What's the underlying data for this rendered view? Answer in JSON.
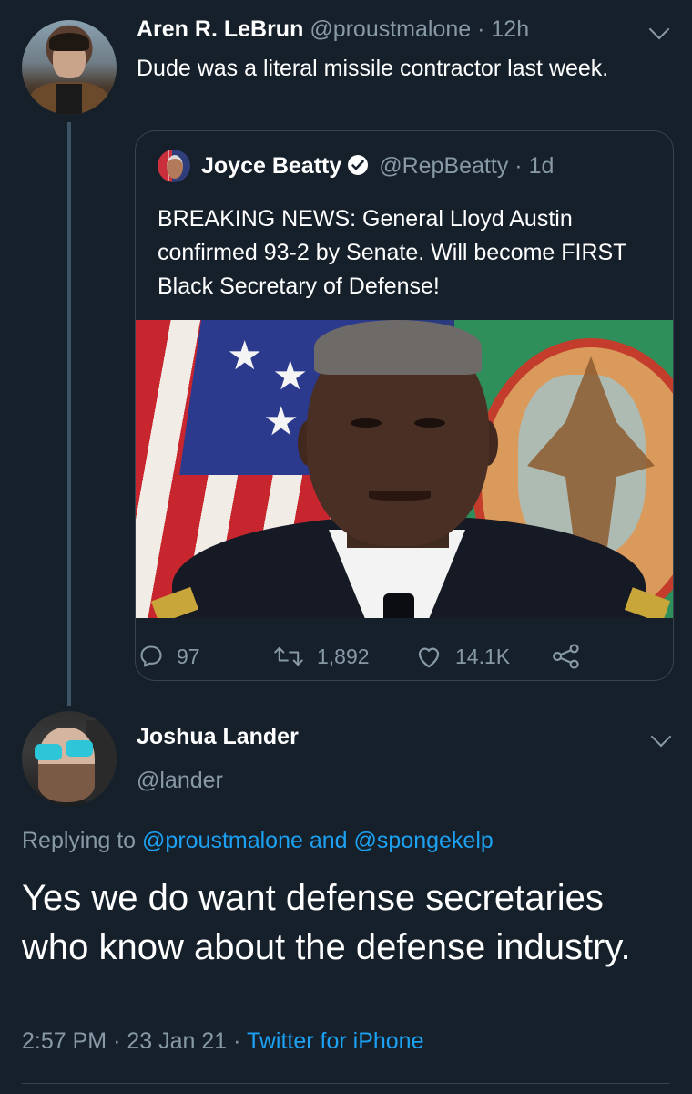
{
  "tweet1": {
    "display_name": "Aren R. LeBrun",
    "handle": "@proustmalone",
    "time": "12h",
    "separator": "·",
    "text": "Dude was a literal missile contractor last week."
  },
  "quote": {
    "display_name": "Joyce Beatty",
    "handle": "@RepBeatty",
    "time": "1d",
    "separator": "·",
    "text": "BREAKING NEWS: General Lloyd Austin confirmed 93-2 by Senate. Will become FIRST Black Secretary of Defense!",
    "verified": true
  },
  "actions": {
    "replies": "97",
    "retweets": "1,892",
    "likes": "14.1K"
  },
  "tweet2": {
    "display_name": "Joshua Lander",
    "handle": "@lander",
    "replying_prefix": "Replying to",
    "replying_user1": "@proustmalone",
    "replying_and": "and",
    "replying_user2": "@spongekelp",
    "text": "Yes we do want defense secretaries who know about the defense industry.",
    "time": "2:57 PM",
    "date": "23 Jan 21",
    "source": "Twitter for iPhone",
    "separator": "·"
  },
  "colors": {
    "background": "#15202b",
    "muted": "#8899a6",
    "accent": "#1da1f2",
    "border": "#38444d"
  }
}
